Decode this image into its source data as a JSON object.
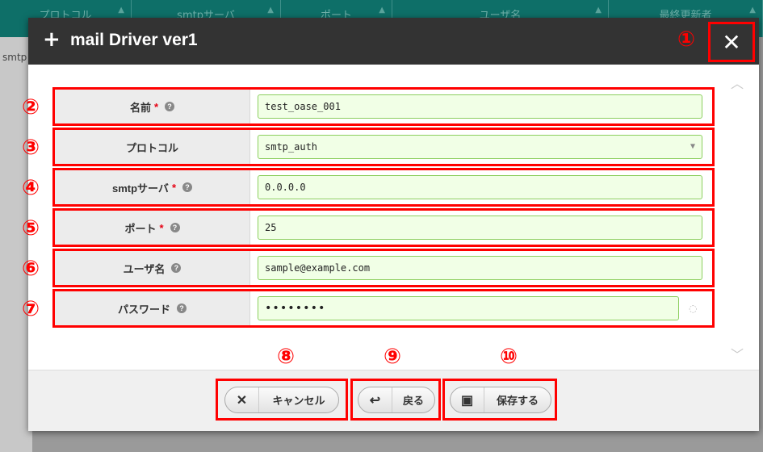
{
  "background": {
    "columns": [
      {
        "label": "プロトコル"
      },
      {
        "label": "smtpサーバ"
      },
      {
        "label": "ポート"
      },
      {
        "label": "ユーザ名"
      },
      {
        "label": "最終更新者"
      }
    ],
    "side_text": "smtp"
  },
  "modal": {
    "title": "mail Driver ver1",
    "close_glyph": "✕",
    "fields": [
      {
        "label": "名前",
        "required": "*",
        "value": "test_oase_001"
      },
      {
        "label": "プロトコル",
        "value": "smtp_auth"
      },
      {
        "label": "smtpサーバ",
        "required": "*",
        "value": "0.0.0.0"
      },
      {
        "label": "ポート",
        "required": "*",
        "value": "25"
      },
      {
        "label": "ユーザ名",
        "value": "sample@example.com"
      },
      {
        "label": "パスワード",
        "value": "••••••••"
      }
    ],
    "buttons": {
      "cancel": "キャンセル",
      "back": "戻る",
      "save": "保存する"
    }
  },
  "annotations": [
    "①",
    "②",
    "③",
    "④",
    "⑤",
    "⑥",
    "⑦",
    "⑧",
    "⑨",
    "⑩"
  ],
  "colors": {
    "header_bg": "#333333",
    "highlight": "#ff0000",
    "field_bg": "#f1ffe6",
    "field_border": "#8ccf5e",
    "required": "#e60012"
  }
}
